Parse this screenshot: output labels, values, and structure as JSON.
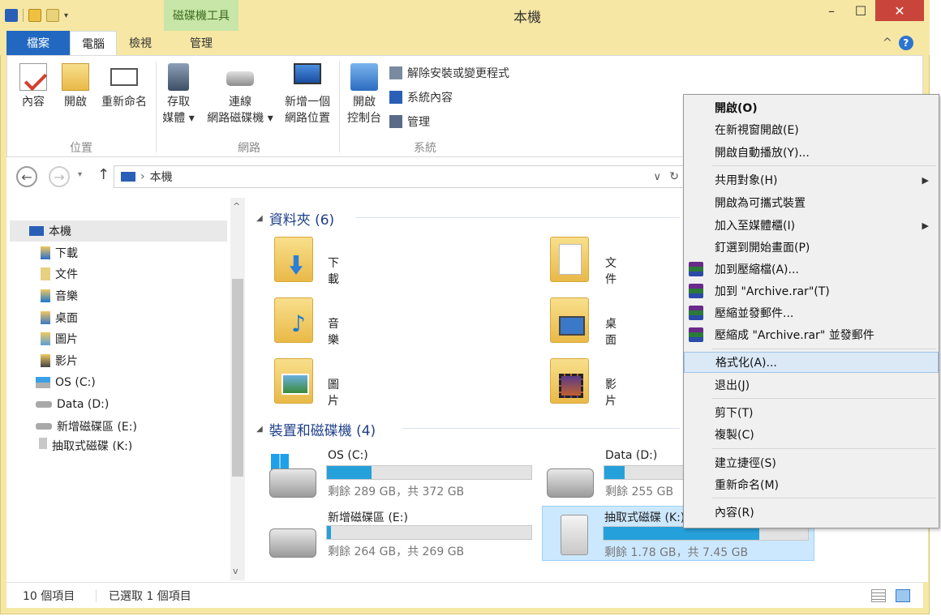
{
  "window": {
    "title": "本機",
    "tool_tab": "磁碟機工具",
    "min_symbol": "–",
    "max_symbol": "☐",
    "close_symbol": "✕"
  },
  "tabs": {
    "file": "檔案",
    "computer": "電腦",
    "view": "檢視",
    "manage": "管理"
  },
  "ribbon": {
    "location": {
      "label": "位置",
      "properties": "內容",
      "open": "開啟",
      "rename": "重新命名"
    },
    "network": {
      "label": "網路",
      "access_media_1": "存取",
      "access_media_2": "媒體 ▾",
      "map_drive_1": "連線",
      "map_drive_2": "網路磁碟機 ▾",
      "add_location_1": "新增一個",
      "add_location_2": "網路位置"
    },
    "system": {
      "label": "系統",
      "control_panel_1": "開啟",
      "control_panel_2": "控制台",
      "uninstall": "解除安裝或變更程式",
      "sys_props": "系統內容",
      "manage": "管理"
    }
  },
  "address": {
    "path": "本機",
    "separator": "›",
    "refresh": "↻",
    "dropdown": "∨"
  },
  "nav": {
    "root": "本機",
    "items": [
      "下載",
      "文件",
      "音樂",
      "桌面",
      "圖片",
      "影片",
      "OS (C:)",
      "Data (D:)",
      "新增磁碟區 (E:)",
      "抽取式磁碟 (K:)"
    ]
  },
  "content": {
    "folders_header": "資料夾 (6)",
    "folders": [
      "下載",
      "文件",
      "音樂",
      "桌面",
      "圖片",
      "影片"
    ],
    "drives_header": "裝置和磁碟機 (4)",
    "drives": [
      {
        "name": "OS (C:)",
        "free": "剩餘 289 GB，共 372 GB",
        "used_fraction": 0.22
      },
      {
        "name": "Data (D:)",
        "free": "剩餘 255 GB",
        "used_fraction": 0.1
      },
      {
        "name": "新增磁碟區 (E:)",
        "free": "剩餘 264 GB，共 269 GB",
        "used_fraction": 0.02
      },
      {
        "name": "抽取式磁碟 (K:)",
        "free": "剩餘 1.78 GB，共 7.45 GB",
        "used_fraction": 0.76
      }
    ]
  },
  "status": {
    "count": "10 個項目",
    "selected": "已選取 1 個項目"
  },
  "context_menu": {
    "open": "開啟(O)",
    "open_new_window": "在新視窗開啟(E)",
    "autoplay": "開啟自動播放(Y)...",
    "share": "共用對象(H)",
    "open_portable": "開啟為可攜式裝置",
    "add_library": "加入至媒體櫃(I)",
    "pin_start": "釘選到開始畫面(P)",
    "add_archive": "加到壓縮檔(A)...",
    "add_rar": "加到 \"Archive.rar\"(T)",
    "compress_email": "壓縮並發郵件...",
    "compress_rar_email": "壓縮成 \"Archive.rar\" 並發郵件",
    "format": "格式化(A)...",
    "eject": "退出(J)",
    "cut": "剪下(T)",
    "copy": "複製(C)",
    "create_shortcut": "建立捷徑(S)",
    "rename": "重新命名(M)",
    "properties": "內容(R)",
    "submenu_arrow": "▶"
  },
  "colors": {
    "accent": "#2268c0",
    "title_bg": "#f6e7a4",
    "tool_tab": "#c7e6a8",
    "close": "#c9443a",
    "drive_fill": "#26a0da",
    "selection": "#cce8ff"
  }
}
